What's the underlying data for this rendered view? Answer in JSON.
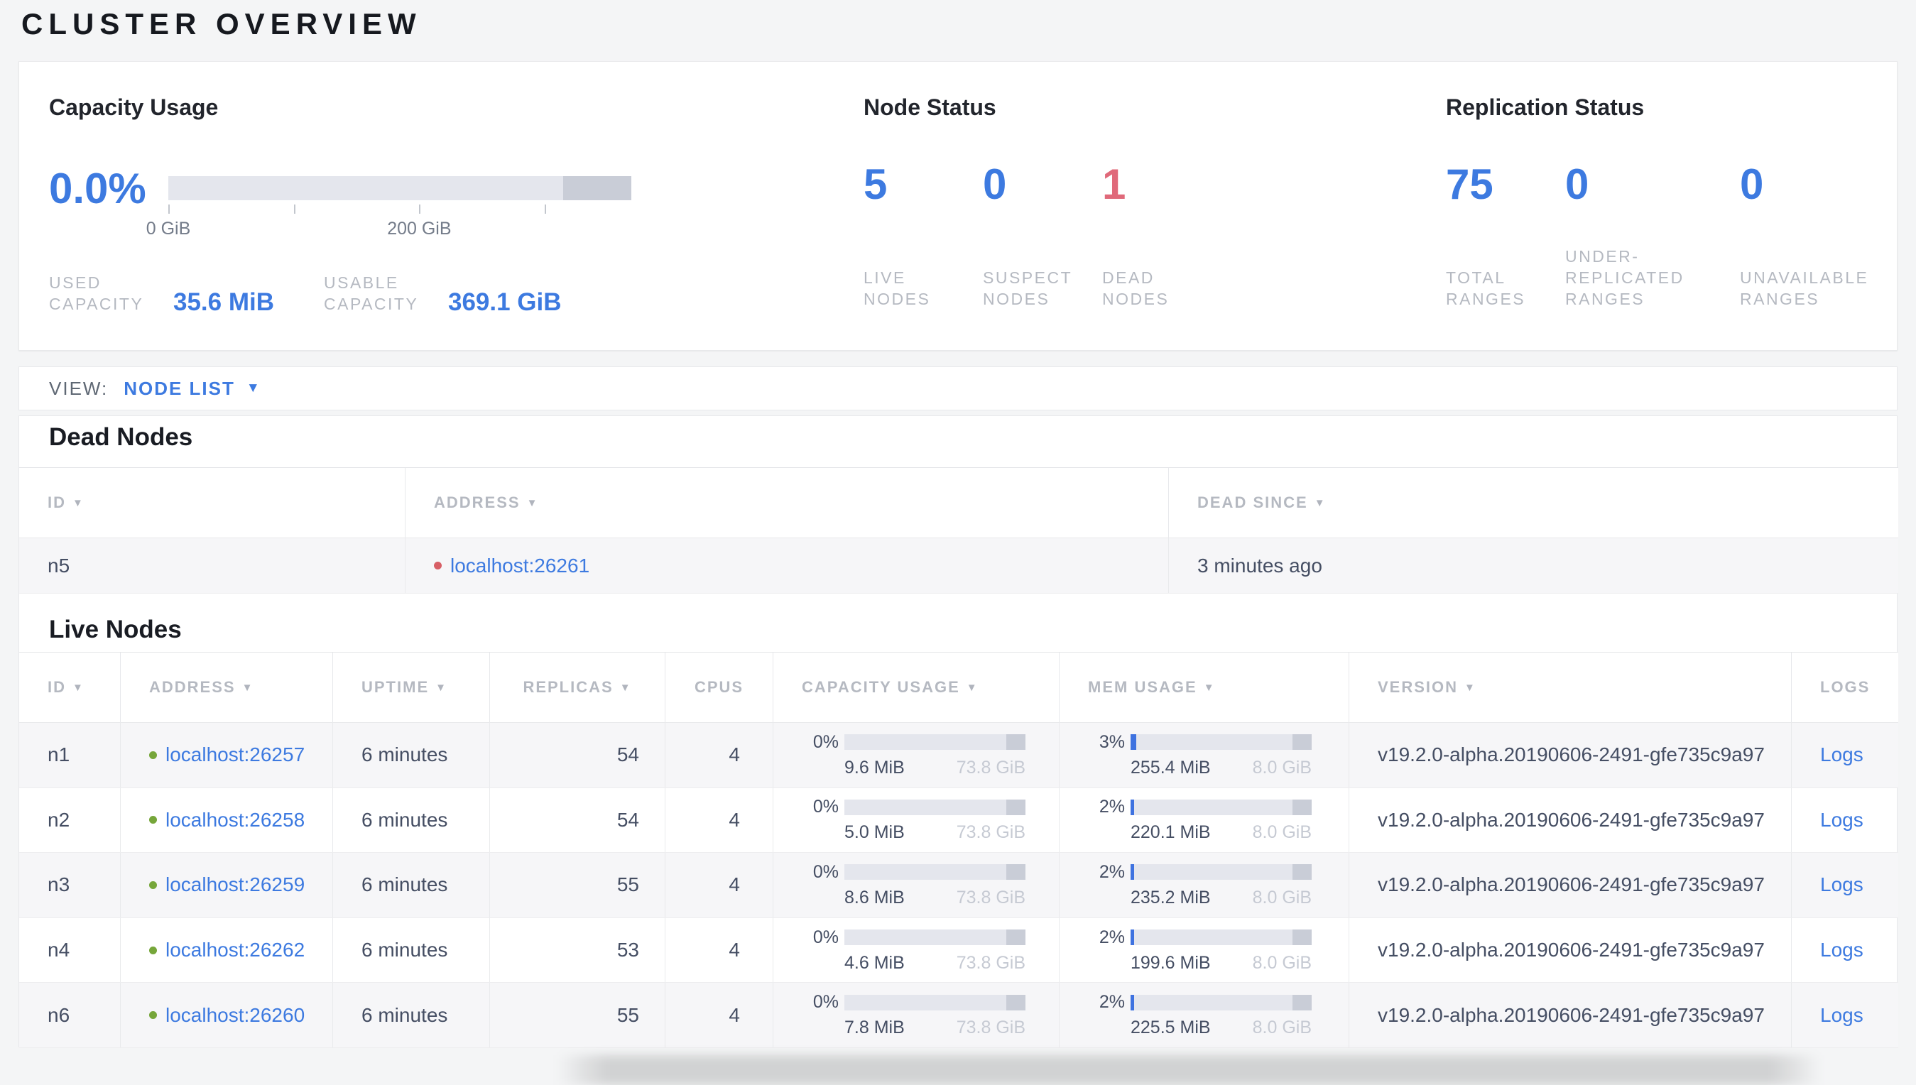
{
  "page": {
    "title": "CLUSTER OVERVIEW"
  },
  "ui": {
    "sort_icon": "▼",
    "dropdown_icon": "▼"
  },
  "summary": {
    "capacity": {
      "title": "Capacity Usage",
      "percent": "0.0%",
      "bar": {
        "fill": "0%",
        "reserved": "14.7%"
      },
      "ticks": [
        {
          "pos": "0%",
          "label": "0 GiB"
        },
        {
          "pos": "27.1%",
          "label": ""
        },
        {
          "pos": "54.2%",
          "label": "200 GiB"
        },
        {
          "pos": "81.3%",
          "label": ""
        }
      ],
      "stats": [
        {
          "label": "USED CAPACITY",
          "value": "35.6 MiB"
        },
        {
          "label": "USABLE CAPACITY",
          "value": "369.1 GiB"
        }
      ]
    },
    "node_status": {
      "title": "Node Status",
      "stats": [
        {
          "value": "5",
          "label": "LIVE NODES",
          "tone": "blue"
        },
        {
          "value": "0",
          "label": "SUSPECT NODES",
          "tone": "blue"
        },
        {
          "value": "1",
          "label": "DEAD NODES",
          "tone": "red"
        }
      ]
    },
    "replication": {
      "title": "Replication Status",
      "stats": [
        {
          "value": "75",
          "label": "TOTAL RANGES",
          "tone": "blue"
        },
        {
          "value": "0",
          "label": "UNDER-REPLICATED RANGES",
          "tone": "blue"
        },
        {
          "value": "0",
          "label": "UNAVAILABLE RANGES",
          "tone": "blue"
        }
      ]
    }
  },
  "view_bar": {
    "label": "VIEW:",
    "selected": "NODE LIST"
  },
  "dead_nodes": {
    "heading": "Dead Nodes",
    "columns": [
      "ID",
      "ADDRESS",
      "DEAD SINCE"
    ],
    "rows": [
      {
        "id": "n5",
        "address": "localhost:26261",
        "dead_since": "3 minutes ago"
      }
    ]
  },
  "live_nodes": {
    "heading": "Live Nodes",
    "columns": [
      "ID",
      "ADDRESS",
      "UPTIME",
      "REPLICAS",
      "CPUS",
      "CAPACITY USAGE",
      "MEM USAGE",
      "VERSION",
      "LOGS"
    ],
    "rows": [
      {
        "id": "n1",
        "address": "localhost:26257",
        "uptime": "6 minutes",
        "replicas": "54",
        "cpus": "4",
        "capacity": {
          "pct": "0%",
          "fill": "0%",
          "reserved": "10.5%",
          "used": "9.6 MiB",
          "total": "73.8 GiB"
        },
        "mem": {
          "pct": "3%",
          "fill": "3%",
          "reserved": "10.5%",
          "used": "255.4 MiB",
          "total": "8.0 GiB"
        },
        "version": "v19.2.0-alpha.20190606-2491-gfe735c9a97",
        "logs": "Logs"
      },
      {
        "id": "n2",
        "address": "localhost:26258",
        "uptime": "6 minutes",
        "replicas": "54",
        "cpus": "4",
        "capacity": {
          "pct": "0%",
          "fill": "0%",
          "reserved": "10.5%",
          "used": "5.0 MiB",
          "total": "73.8 GiB"
        },
        "mem": {
          "pct": "2%",
          "fill": "2%",
          "reserved": "10.5%",
          "used": "220.1 MiB",
          "total": "8.0 GiB"
        },
        "version": "v19.2.0-alpha.20190606-2491-gfe735c9a97",
        "logs": "Logs"
      },
      {
        "id": "n3",
        "address": "localhost:26259",
        "uptime": "6 minutes",
        "replicas": "55",
        "cpus": "4",
        "capacity": {
          "pct": "0%",
          "fill": "0%",
          "reserved": "10.5%",
          "used": "8.6 MiB",
          "total": "73.8 GiB"
        },
        "mem": {
          "pct": "2%",
          "fill": "2%",
          "reserved": "10.5%",
          "used": "235.2 MiB",
          "total": "8.0 GiB"
        },
        "version": "v19.2.0-alpha.20190606-2491-gfe735c9a97",
        "logs": "Logs"
      },
      {
        "id": "n4",
        "address": "localhost:26262",
        "uptime": "6 minutes",
        "replicas": "53",
        "cpus": "4",
        "capacity": {
          "pct": "0%",
          "fill": "0%",
          "reserved": "10.5%",
          "used": "4.6 MiB",
          "total": "73.8 GiB"
        },
        "mem": {
          "pct": "2%",
          "fill": "2%",
          "reserved": "10.5%",
          "used": "199.6 MiB",
          "total": "8.0 GiB"
        },
        "version": "v19.2.0-alpha.20190606-2491-gfe735c9a97",
        "logs": "Logs"
      },
      {
        "id": "n6",
        "address": "localhost:26260",
        "uptime": "6 minutes",
        "replicas": "55",
        "cpus": "4",
        "capacity": {
          "pct": "0%",
          "fill": "0%",
          "reserved": "10.5%",
          "used": "7.8 MiB",
          "total": "73.8 GiB"
        },
        "mem": {
          "pct": "2%",
          "fill": "2%",
          "reserved": "10.5%",
          "used": "225.5 MiB",
          "total": "8.0 GiB"
        },
        "version": "v19.2.0-alpha.20190606-2491-gfe735c9a97",
        "logs": "Logs"
      }
    ]
  },
  "colors": {
    "accent_blue": "#3d7ae0",
    "danger_red": "#e0697a",
    "live_dot_green": "#76a63a",
    "dead_dot_red": "#d75f66",
    "bar_track": "#e4e6ed",
    "bar_reserved": "#c9cdd7",
    "bar_fill": "#3e72e0"
  }
}
